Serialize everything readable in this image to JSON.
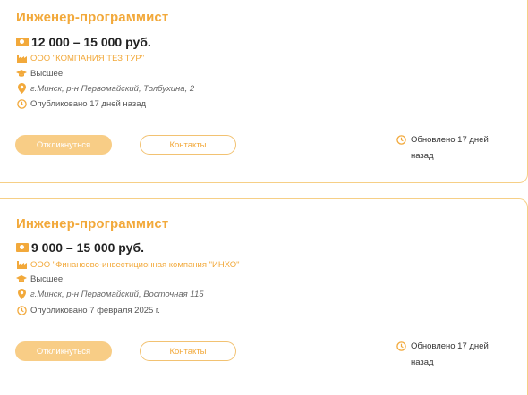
{
  "vacancies": [
    {
      "title": "Инженер-программист",
      "salary": "12 000 – 15 000 руб.",
      "company": "ООО \"КОМПАНИЯ ТЕЗ ТУР\"",
      "education": "Высшее",
      "address": "г.Минск, р-н Первомайский, Толбухина, 2",
      "published": "Опубликовано 17 дней назад",
      "apply_label": "Откликнуться",
      "contacts_label": "Контакты",
      "updated": "Обновлено 17 дней назад"
    },
    {
      "title": "Инженер-программист",
      "salary": "9 000 – 15 000 руб.",
      "company": "ООО \"Финансово-инвестиционная компания \"ИНХО\"",
      "education": "Высшее",
      "address": "г.Минск, р-н Первомайский, Восточная 115",
      "published": "Опубликовано 7 февраля 2025 г.",
      "apply_label": "Откликнуться",
      "contacts_label": "Контакты",
      "updated": "Обновлено 17 дней назад"
    }
  ],
  "colors": {
    "accent": "#f2a93b",
    "button_fill": "#f8cd86",
    "border": "#f6cf86"
  },
  "icons": {
    "salary": "money-icon",
    "company": "building-icon",
    "education": "graduation-cap-icon",
    "address": "map-pin-icon",
    "published": "clock-icon",
    "updated": "clock-icon"
  }
}
